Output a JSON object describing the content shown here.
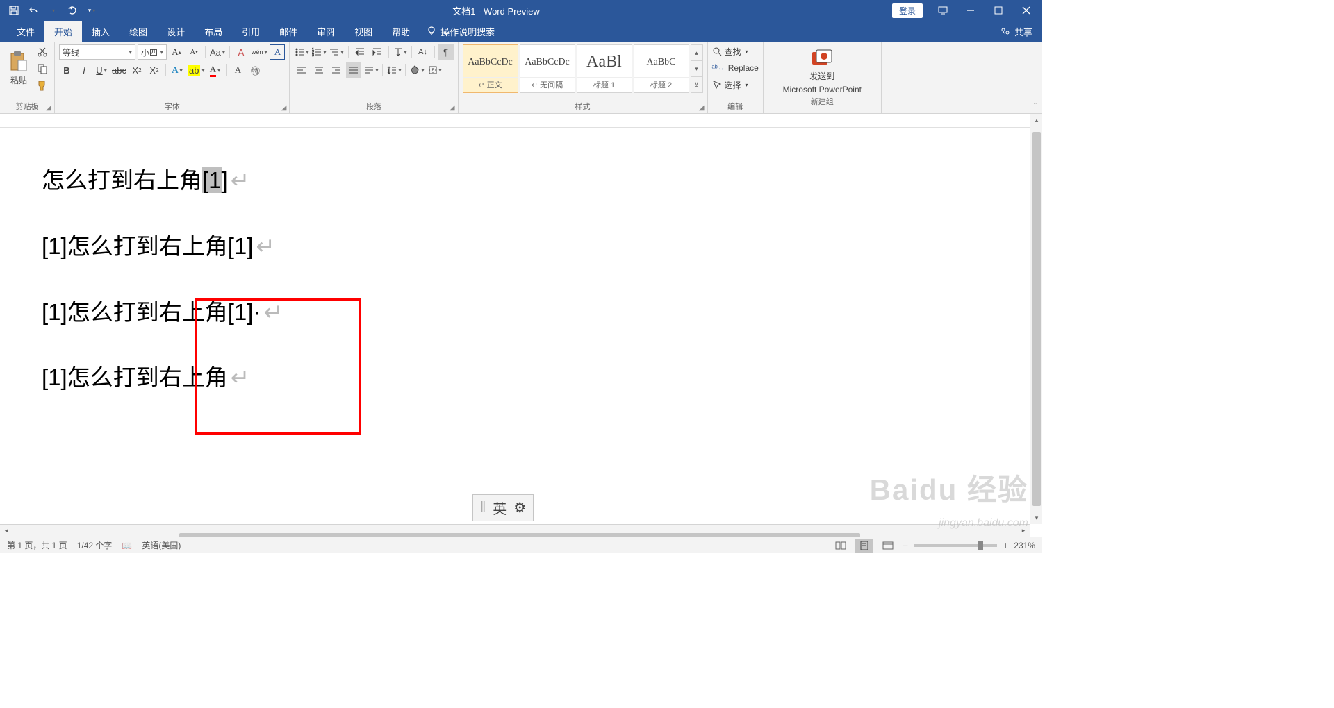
{
  "title": "文档1 - Word Preview",
  "login": "登录",
  "share": "共享",
  "tabs": {
    "file": "文件",
    "home": "开始",
    "insert": "插入",
    "draw": "绘图",
    "design": "设计",
    "layout": "布局",
    "references": "引用",
    "mailings": "邮件",
    "review": "审阅",
    "view": "视图",
    "help": "帮助",
    "tellme": "操作说明搜索"
  },
  "ribbon": {
    "clipboard": {
      "paste": "粘贴",
      "label": "剪贴板"
    },
    "font": {
      "name": "等线",
      "size": "小四",
      "label": "字体"
    },
    "paragraph": {
      "label": "段落"
    },
    "styles": {
      "items": [
        {
          "preview": "AaBbCcDc",
          "name": "↵ 正文",
          "sel": true
        },
        {
          "preview": "AaBbCcDc",
          "name": "↵ 无间隔"
        },
        {
          "preview": "AaBl",
          "name": "标题 1",
          "big": true
        },
        {
          "preview": "AaBbC",
          "name": "标题 2"
        }
      ],
      "label": "样式"
    },
    "editing": {
      "find": "查找",
      "replace": "Replace",
      "select": "选择",
      "label": "编辑"
    },
    "ppt": {
      "line1": "发送到",
      "line2": "Microsoft PowerPoint",
      "label": "新建组"
    }
  },
  "document": {
    "lines": [
      {
        "pre": "怎么打到右上角",
        "sel": "[1",
        "post": "]",
        "mark": "↵"
      },
      {
        "pre": "[1]怎么打到右上角[1]",
        "sel": "",
        "post": "",
        "mark": "↵"
      },
      {
        "pre": "[1]怎么打到右上角[1]·",
        "sel": "",
        "post": "",
        "mark": "↵"
      },
      {
        "pre": "[1]怎么打到右上角",
        "sel": "",
        "post": "",
        "mark": "↵"
      }
    ]
  },
  "ime": "英",
  "status": {
    "page": "第 1 页，共 1 页",
    "words": "1/42 个字",
    "lang": "英语(美国)",
    "zoom": "231%"
  }
}
